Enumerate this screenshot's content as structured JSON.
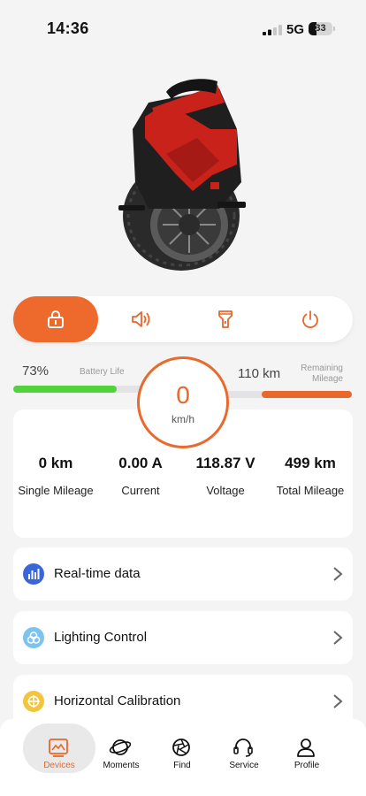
{
  "status_bar": {
    "time": "14:36",
    "network": "5G",
    "battery_level": "33",
    "signal_icon": "signal-bars-icon"
  },
  "colors": {
    "accent": "#E8672A",
    "battery_green": "#52D33C",
    "background": "#F4F4F5"
  },
  "hero": {
    "image_subject": "electric-unicycle-icon"
  },
  "controls": [
    {
      "icon": "lock-icon",
      "active": true
    },
    {
      "icon": "speaker-icon",
      "active": false
    },
    {
      "icon": "flashlight-icon",
      "active": false
    },
    {
      "icon": "power-icon",
      "active": false
    }
  ],
  "gauges": {
    "battery_percent": "73%",
    "battery_fill": 0.73,
    "battery_caption": "Battery Life",
    "remaining_km": "110 km",
    "remaining_caption": "Remaining Mileage",
    "speed_value": "0",
    "speed_unit": "km/h"
  },
  "stats": [
    {
      "value": "0 km",
      "label": "Single Mileage"
    },
    {
      "value": "0.00 A",
      "label": "Current"
    },
    {
      "value": "118.87 V",
      "label": "Voltage"
    },
    {
      "value": "499 km",
      "label": "Total Mileage"
    }
  ],
  "menu": [
    {
      "label": "Real-time data",
      "icon": "chart-icon"
    },
    {
      "label": "Lighting Control",
      "icon": "lighting-icon"
    },
    {
      "label": "Horizontal Calibration",
      "icon": "target-icon"
    }
  ],
  "tabs": [
    {
      "label": "Devices",
      "icon": "devices-icon",
      "active": true
    },
    {
      "label": "Moments",
      "icon": "planet-icon",
      "active": false
    },
    {
      "label": "Find",
      "icon": "aperture-icon",
      "active": false
    },
    {
      "label": "Service",
      "icon": "headset-icon",
      "active": false
    },
    {
      "label": "Profile",
      "icon": "person-icon",
      "active": false
    }
  ]
}
